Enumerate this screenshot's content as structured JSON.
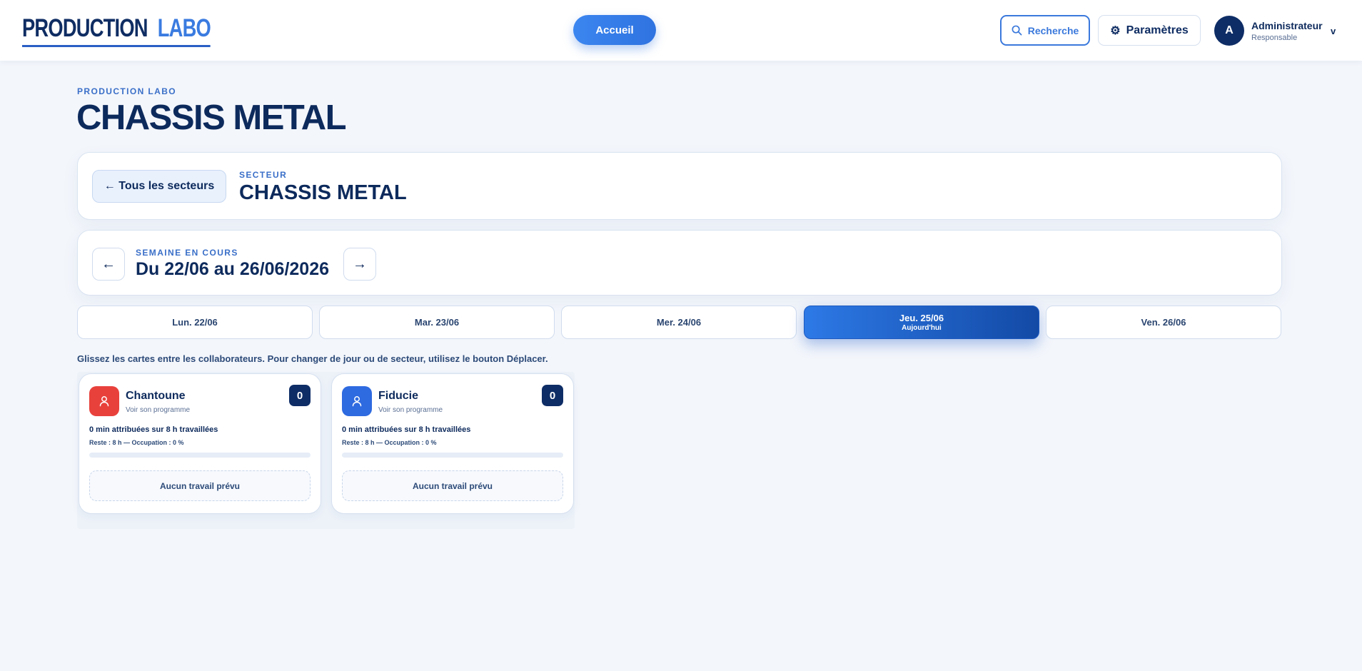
{
  "app": {
    "logo_part1": "PRODUCTION",
    "logo_part2": "LABO",
    "home_label": "Accueil",
    "search_label": "Recherche",
    "settings_label": "Paramètres",
    "user": {
      "initial": "A",
      "name": "Administrateur",
      "role": "Responsable",
      "chevron": "v"
    }
  },
  "header": {
    "eyebrow": "PRODUCTION LABO",
    "title": "CHASSIS METAL"
  },
  "sector": {
    "back_label": "← Tous les secteurs",
    "label": "SECTEUR",
    "name": "CHASSIS METAL"
  },
  "week": {
    "label": "SEMAINE EN COURS",
    "range": "Du 22/06 au 26/06/2026",
    "prev": "←",
    "next": "→"
  },
  "days": [
    {
      "label": "Lun. 22/06",
      "sub": "",
      "active": false
    },
    {
      "label": "Mar. 23/06",
      "sub": "",
      "active": false
    },
    {
      "label": "Mer. 24/06",
      "sub": "",
      "active": false
    },
    {
      "label": "Jeu. 25/06",
      "sub": "Aujourd'hui",
      "active": true
    },
    {
      "label": "Ven. 26/06",
      "sub": "",
      "active": false
    }
  ],
  "hint": "Glissez les cartes entre les collaborateurs. Pour changer de jour ou de secteur, utilisez le bouton Déplacer.",
  "workers": [
    {
      "name": "Chantoune",
      "link": "Voir son programme",
      "count": "0",
      "color": "#e8413c",
      "stat": "0 min attribuées sur 8 h travaillées",
      "rest": "Reste : 8 h — Occupation : 0 %",
      "occupation": 0,
      "empty": "Aucun travail prévu"
    },
    {
      "name": "Fiducie",
      "link": "Voir son programme",
      "count": "0",
      "color": "#2e6ae0",
      "stat": "0 min attribuées sur 8 h travaillées",
      "rest": "Reste : 8 h — Occupation : 0 %",
      "occupation": 0,
      "empty": "Aucun travail prévu"
    }
  ]
}
